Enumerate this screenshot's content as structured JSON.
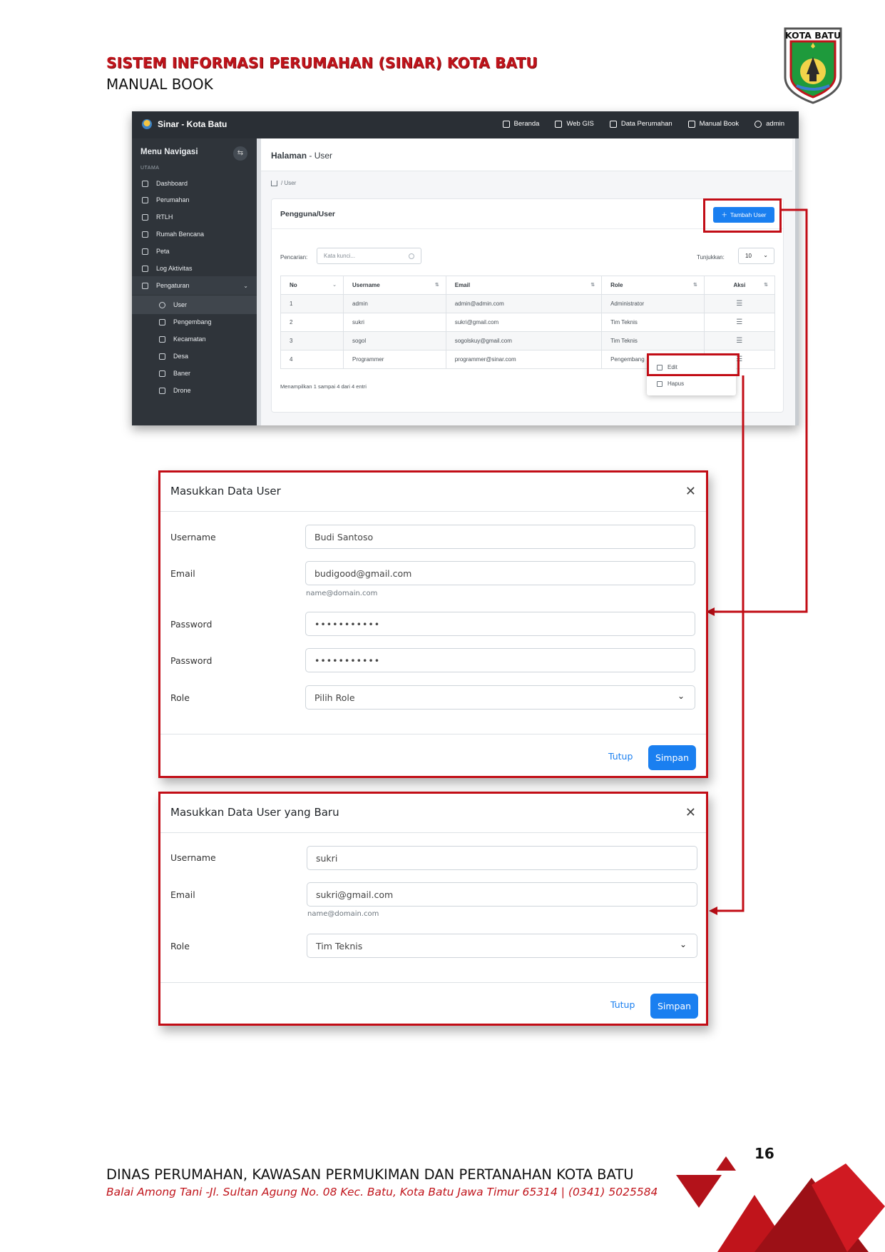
{
  "header": {
    "title": "SISTEM INFORMASI PERUMAHAN (SINAR) KOTA BATU",
    "subtitle": "MANUAL BOOK",
    "logo_text": "KOTA BATU"
  },
  "app": {
    "brand": "Sinar - Kota Batu",
    "topnav": [
      "Beranda",
      "Web GIS",
      "Data Perumahan",
      "Manual Book",
      "admin"
    ],
    "sidebar": {
      "heading": "Menu Navigasi",
      "section": "UTAMA",
      "items": [
        "Dashboard",
        "Perumahan",
        "RTLH",
        "Rumah Bencana",
        "Peta",
        "Log Aktivitas",
        "Pengaturan"
      ],
      "subitems": [
        "User",
        "Pengembang",
        "Kecamatan",
        "Desa",
        "Baner",
        "Drone"
      ]
    },
    "page_title_prefix": "Halaman",
    "page_title_suffix": " - User",
    "breadcrumb": "/  User",
    "card_title": "Pengguna/User",
    "add_button": "Tambah User",
    "search_label": "Pencarian:",
    "search_placeholder": "Kata kunci...",
    "show_label": "Tunjukkan:",
    "show_value": "10",
    "table": {
      "headers": [
        "No",
        "Username",
        "Email",
        "Role",
        "Aksi"
      ],
      "rows": [
        [
          "1",
          "admin",
          "admin@admin.com",
          "Administrator"
        ],
        [
          "2",
          "sukri",
          "sukri@gmail.com",
          "Tim Teknis"
        ],
        [
          "3",
          "sogol",
          "sogolskuy@gmail.com",
          "Tim Teknis"
        ],
        [
          "4",
          "Programmer",
          "programmer@sinar.com",
          "Pengembang"
        ]
      ]
    },
    "table_info": "Menampilkan 1 sampai 4 dari 4 entri",
    "pager_current": "1",
    "dropdown": [
      "Edit",
      "Hapus"
    ]
  },
  "modal_add": {
    "title": "Masukkan Data User",
    "labels": [
      "Username",
      "Email",
      "Password",
      "Password",
      "Role"
    ],
    "username": "Budi Santoso",
    "email": "budigood@gmail.com",
    "email_help": "name@domain.com",
    "password": "•••••••••••",
    "password_confirm": "•••••••••••",
    "role": "Pilih Role",
    "cancel": "Tutup",
    "save": "Simpan"
  },
  "modal_edit": {
    "title": "Masukkan Data User yang Baru",
    "labels": [
      "Username",
      "Email",
      "Role"
    ],
    "username": "sukri",
    "email": "sukri@gmail.com",
    "email_help": "name@domain.com",
    "role": "Tim Teknis",
    "cancel": "Tutup",
    "save": "Simpan"
  },
  "footer": {
    "org": "DINAS PERUMAHAN, KAWASAN PERMUKIMAN DAN PERTANAHAN KOTA BATU",
    "address": "Balai Among Tani -Jl. Sultan Agung No. 08 Kec. Batu, Kota Batu Jawa Timur 65314 | (0341) 5025584",
    "page_number": "16"
  },
  "colors": {
    "accent_red": "#c20d16",
    "primary_blue": "#1a7ff0",
    "navbar_dark": "#2a2f35"
  }
}
